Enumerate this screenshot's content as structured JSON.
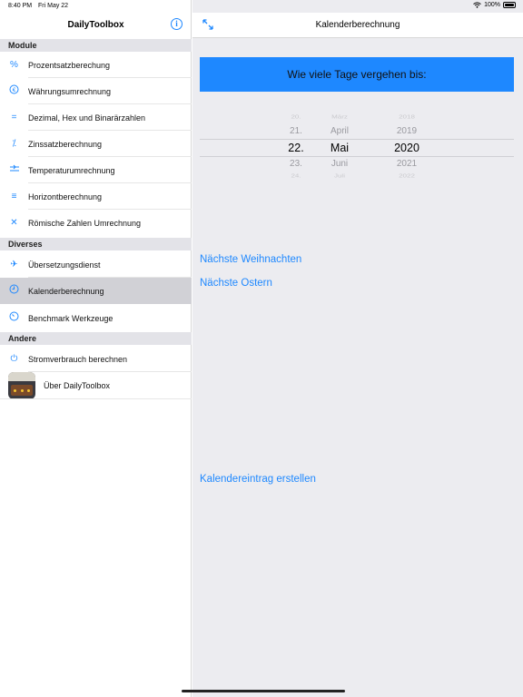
{
  "status": {
    "time": "8:40 PM",
    "date": "Fri May 22",
    "battery": "100%",
    "wifi_icon": "wifi-icon",
    "battery_level": 1.0
  },
  "sidebar": {
    "title": "DailyToolbox",
    "info_icon": "info-icon",
    "sections": [
      {
        "header": "Module",
        "items": [
          {
            "label": "Prozentsatzberechung",
            "icon": "percent-icon"
          },
          {
            "label": "Währungsumrechnung",
            "icon": "currency-icon"
          },
          {
            "label": "Dezimal, Hex und Binarärzahlen",
            "icon": "equals-icon"
          },
          {
            "label": "Zinssatzberechnung",
            "icon": "divide-icon"
          },
          {
            "label": "Temperaturumrechnung",
            "icon": "thermometer-icon"
          },
          {
            "label": "Horizontberechnung",
            "icon": "horizon-icon"
          },
          {
            "label": "Römische Zahlen Umrechnung",
            "icon": "close-icon"
          }
        ]
      },
      {
        "header": "Diverses",
        "items": [
          {
            "label": "Übersetzungsdienst",
            "icon": "airplane-icon"
          },
          {
            "label": "Kalenderberechnung",
            "icon": "clock-icon",
            "selected": true
          },
          {
            "label": "Benchmark Werkzeuge",
            "icon": "stopwatch-icon"
          }
        ]
      },
      {
        "header": "Andere",
        "items": [
          {
            "label": "Stromverbrauch berechnen",
            "icon": "power-icon"
          },
          {
            "label": "Über DailyToolbox",
            "icon": "app-icon"
          }
        ]
      }
    ]
  },
  "main": {
    "title": "Kalenderberechnung",
    "expand_icon": "expand-icon",
    "banner": "Wie viele Tage vergehen bis:",
    "picker": {
      "rows": [
        {
          "day": "20.",
          "month": "März",
          "year": "2018"
        },
        {
          "day": "21.",
          "month": "April",
          "year": "2019"
        },
        {
          "day": "22.",
          "month": "Mai",
          "year": "2020"
        },
        {
          "day": "23.",
          "month": "Juni",
          "year": "2021"
        },
        {
          "day": "24.",
          "month": "Juli",
          "year": "2022"
        }
      ],
      "selected_index": 2
    },
    "link_christmas": "Nächste Weihnachten",
    "link_easter": "Nächste Ostern",
    "link_calendar": "Kalendereintrag erstellen"
  }
}
